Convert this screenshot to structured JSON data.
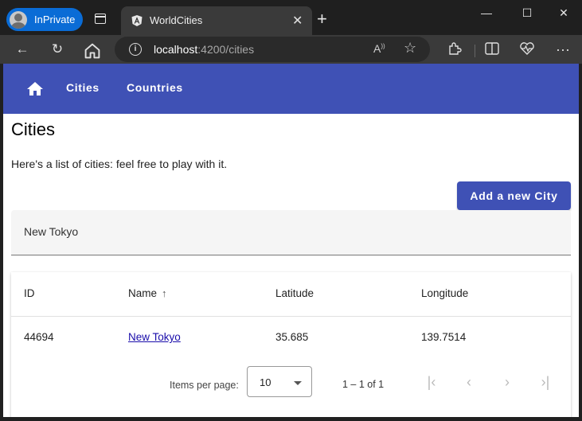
{
  "browser": {
    "profile_label": "InPrivate",
    "tab_title": "WorldCities",
    "url_host": "localhost",
    "url_rest": ":4200/cities",
    "icons": [
      "back-icon",
      "refresh-icon",
      "home-icon",
      "info-icon",
      "read-aloud-icon",
      "favorite-star-icon",
      "extensions-icon",
      "split-screen-icon",
      "health-icon",
      "more-icon"
    ]
  },
  "app": {
    "nav": {
      "cities_label": "Cities",
      "countries_label": "Countries"
    },
    "accent_color": "#3f51b5"
  },
  "page": {
    "title": "Cities",
    "description": "Here's a list of cities: feel free to play with it.",
    "add_button_label": "Add a new City",
    "filter_value": "New Tokyo"
  },
  "table": {
    "headers": {
      "id": "ID",
      "name": "Name",
      "lat": "Latitude",
      "lon": "Longitude"
    },
    "sort": {
      "column": "Name",
      "direction": "ascending"
    },
    "rows": [
      {
        "id": "44694",
        "name": "New Tokyo",
        "lat": "35.685",
        "lon": "139.7514"
      }
    ]
  },
  "paginator": {
    "items_per_page_label": "Items per page:",
    "page_size": "10",
    "range_label": "1 – 1 of 1"
  }
}
